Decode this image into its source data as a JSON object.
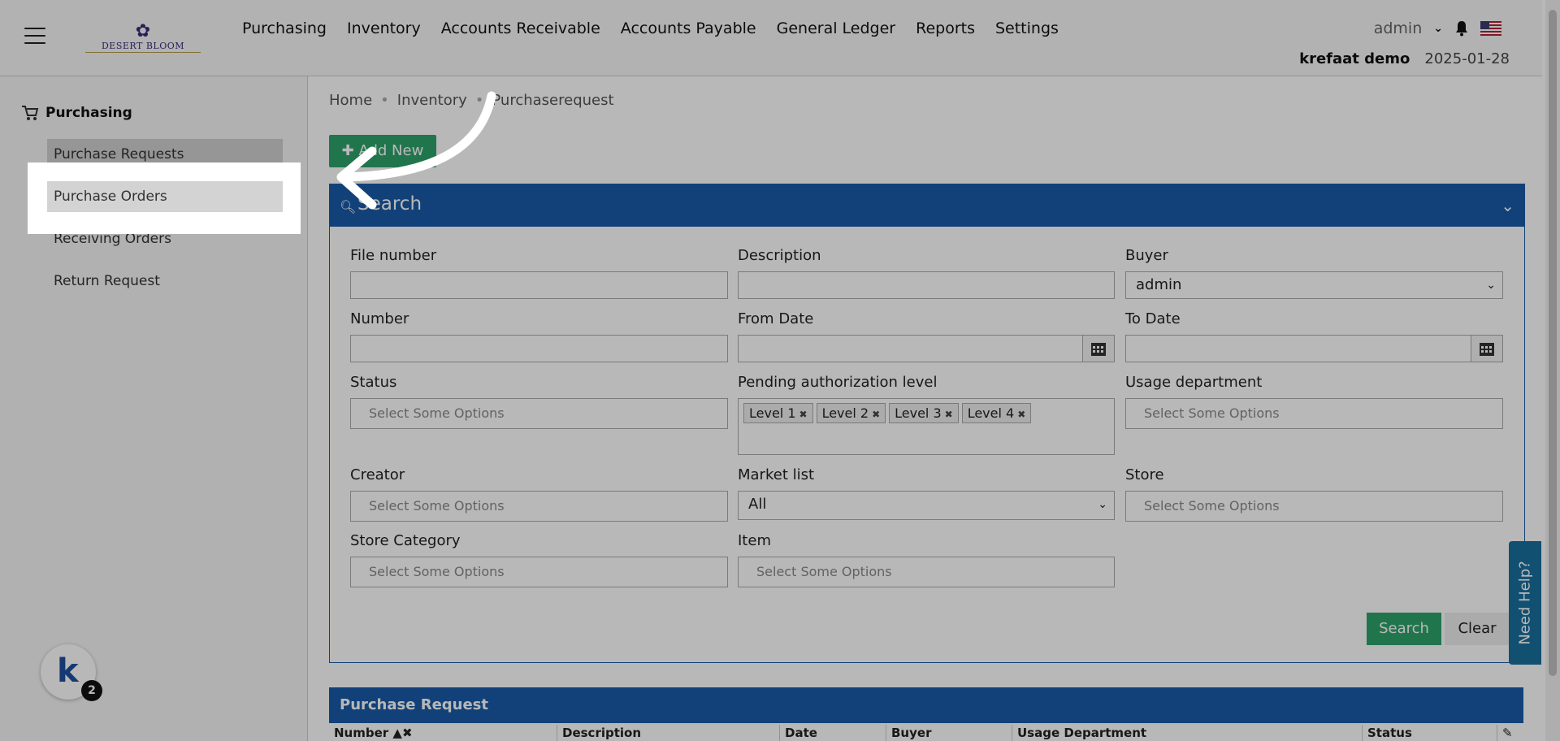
{
  "header": {
    "logo_text": "DESERT BLOOM",
    "nav": [
      "Purchasing",
      "Inventory",
      "Accounts Receivable",
      "Accounts Payable",
      "General Ledger",
      "Reports",
      "Settings"
    ],
    "user": "admin",
    "company": "krefaat demo",
    "date": "2025-01-28"
  },
  "sidebar": {
    "section": "Purchasing",
    "items": [
      "Purchase Requests",
      "Purchase Orders",
      "Receiving Orders",
      "Return Request"
    ]
  },
  "breadcrumb": [
    "Home",
    "Inventory",
    "Purchaserequest"
  ],
  "add_new_label": "Add New",
  "search_panel": {
    "title": "Search",
    "fields": {
      "file_number": "File number",
      "description": "Description",
      "buyer": "Buyer",
      "buyer_value": "admin",
      "number": "Number",
      "from_date": "From Date",
      "to_date": "To Date",
      "status": "Status",
      "pending_level": "Pending authorization level",
      "usage_department": "Usage department",
      "creator": "Creator",
      "market_list": "Market list",
      "market_list_value": "All",
      "store": "Store",
      "store_category": "Store Category",
      "item": "Item"
    },
    "placeholder": "Select Some Options",
    "pending_tags": [
      "Level 1",
      "Level 2",
      "Level 3",
      "Level 4"
    ],
    "search_button": "Search",
    "clear_button": "Clear"
  },
  "results": {
    "title": "Purchase Request",
    "columns": [
      "Number",
      "Description",
      "Date",
      "Buyer",
      "Usage Department",
      "Status"
    ]
  },
  "need_help": "Need Help?",
  "notification_count": "2"
}
